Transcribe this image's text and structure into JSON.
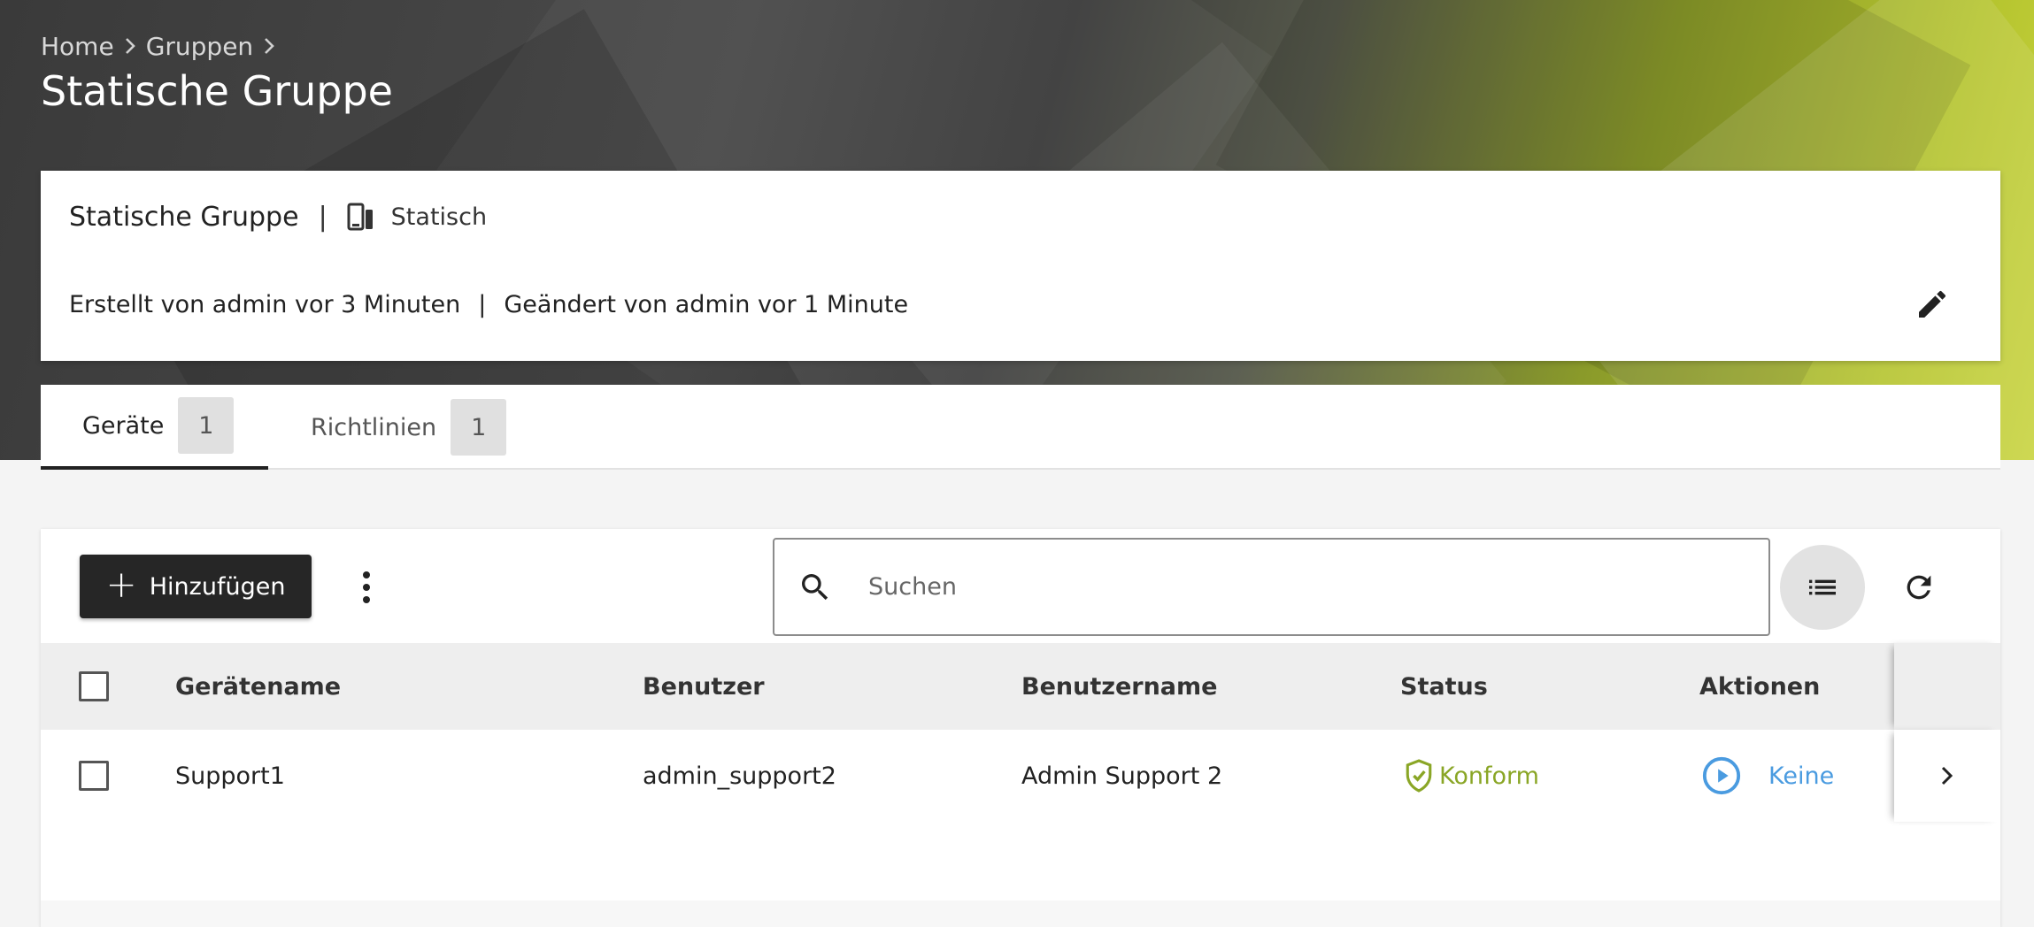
{
  "breadcrumb": {
    "items": [
      "Home",
      "Gruppen"
    ],
    "separator_icon": "chevron-right-icon"
  },
  "page_title": "Statische Gruppe",
  "info_card": {
    "group_name": "Statische Gruppe",
    "separator": "|",
    "type_icon": "device-group-icon",
    "type_label": "Statisch",
    "created": "Erstellt von admin vor 3 Minuten",
    "modified": "Geändert von admin vor 1 Minute",
    "edit_icon": "pencil-icon"
  },
  "tabs": [
    {
      "label": "Geräte",
      "count": "1",
      "active": true
    },
    {
      "label": "Richtlinien",
      "count": "1",
      "active": false
    }
  ],
  "toolbar": {
    "add_label": "Hinzufügen",
    "more_icon": "more-vertical-icon",
    "search_placeholder": "Suchen",
    "view_icon": "list-view-icon",
    "refresh_icon": "refresh-icon"
  },
  "table": {
    "columns": [
      "Gerätename",
      "Benutzer",
      "Benutzername",
      "Status",
      "Aktionen"
    ],
    "rows": [
      {
        "device_name": "Support1",
        "user": "admin_support2",
        "username": "Admin Support 2",
        "status": "Konform",
        "action": "Keine"
      }
    ]
  },
  "colors": {
    "accent_dark": "#262626",
    "status_ok": "#8aa626",
    "action_link": "#4a9be0",
    "hero_lime": "#c9d440"
  }
}
